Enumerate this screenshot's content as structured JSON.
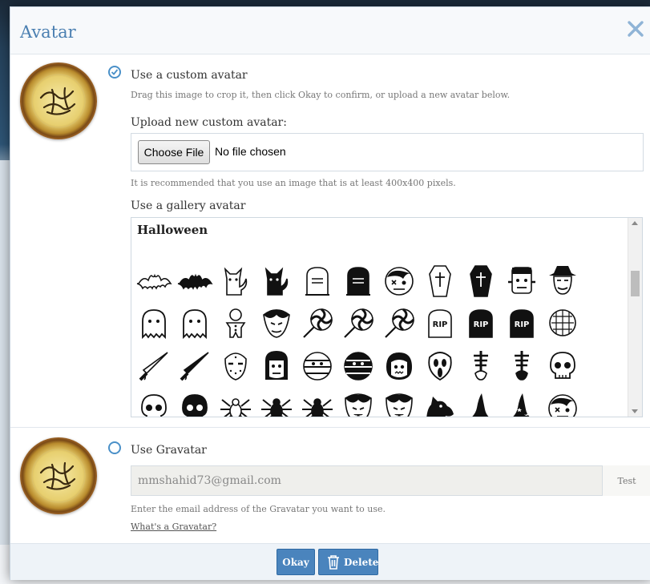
{
  "dialog": {
    "title": "Avatar",
    "custom": {
      "label": "Use a custom avatar",
      "hint": "Drag this image to crop it, then click Okay to confirm, or upload a new avatar below.",
      "upload_label": "Upload new custom avatar:",
      "choose_file_label": "Choose File",
      "file_status": "No file chosen",
      "recommend_hint": "It is recommended that you use an image that is at least 400x400 pixels.",
      "selected": true
    },
    "gallery": {
      "label": "Use a gallery avatar",
      "category": "Halloween",
      "rows": [
        [
          "bat-icon",
          "bat-icon",
          "cat-icon",
          "cat-icon",
          "tombstone-icon",
          "tombstone-icon",
          "zombie-icon",
          "coffin-icon",
          "coffin-icon",
          "frankenstein-icon",
          "witch-hunter-icon"
        ],
        [
          "ghost-icon",
          "ghost-icon",
          "gingerbread-icon",
          "vampire-icon",
          "lollipop-icon",
          "lollipop-icon",
          "lollipop-icon",
          "rip-tombstone-icon",
          "rip-tombstone-icon",
          "rip-tombstone-icon",
          "hellraiser-icon"
        ],
        [
          "knife-icon",
          "knife-icon",
          "hockey-mask-icon",
          "monster-face-icon",
          "mummy-icon",
          "mummy-icon",
          "zombie-face-icon",
          "scream-mask-icon",
          "skeleton-icon",
          "skeleton-icon",
          "skull-icon"
        ],
        [
          "skull-icon",
          "skull-icon",
          "spider-icon",
          "spider-icon",
          "spider-icon",
          "dracula-icon",
          "dracula-icon",
          "werewolf-icon",
          "witch-hat-icon",
          "witch-hat-icon",
          "zombie-icon"
        ]
      ],
      "rip_text": "RIP"
    },
    "gravatar": {
      "label": "Use Gravatar",
      "email_value": "mmshahid73@gmail.com",
      "test_label": "Test",
      "hint": "Enter the email address of the Gravatar you want to use.",
      "link_label": "What's a Gravatar?",
      "selected": false
    },
    "footer": {
      "okay_label": "Okay",
      "delete_label": "Delete"
    }
  },
  "colors": {
    "accent": "#4a90c8",
    "title": "#4a7fb1",
    "button": "#4a84bd"
  }
}
